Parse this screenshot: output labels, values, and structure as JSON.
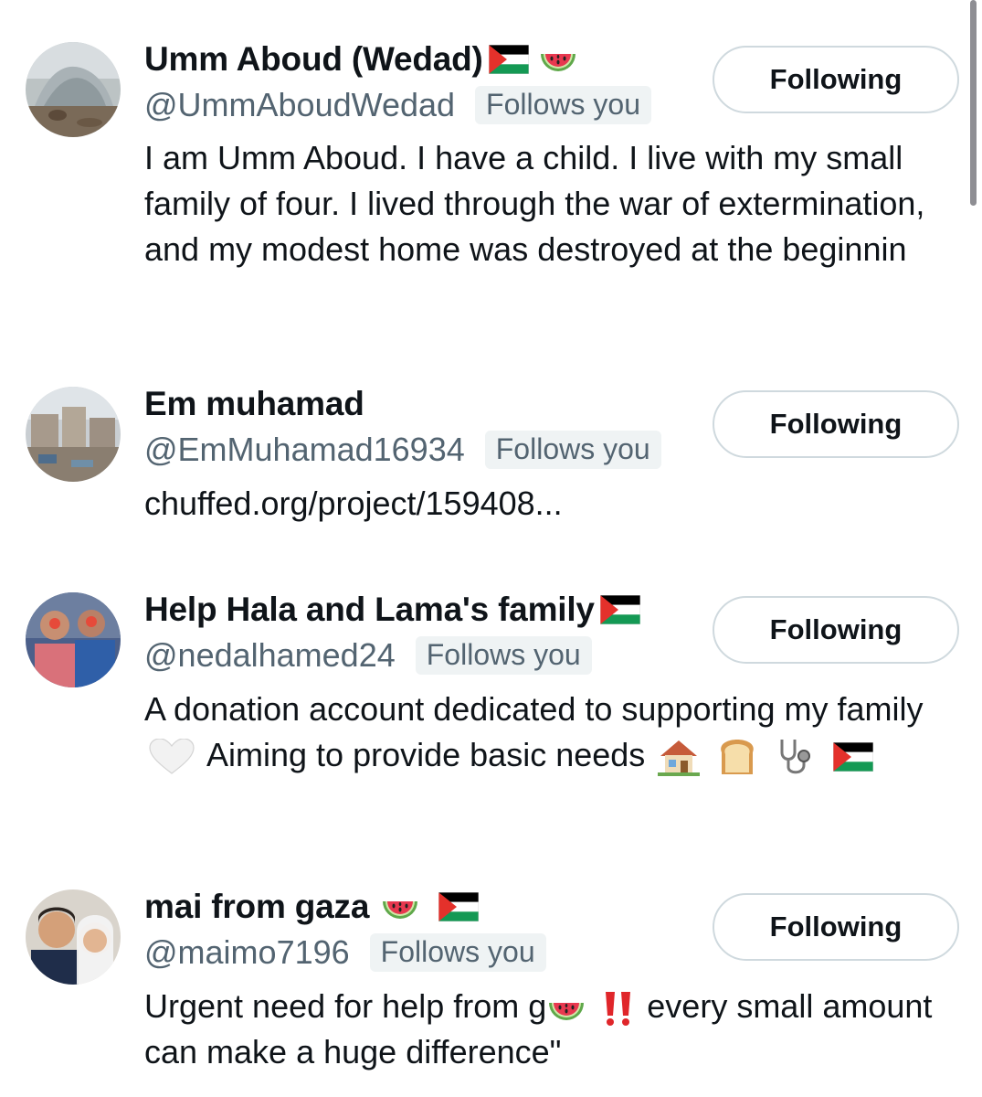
{
  "users": [
    {
      "name": "Umm Aboud (Wedad)",
      "handle": "@UmmAboudWedad",
      "follows_you": "Follows you",
      "button": "Following",
      "bio": "I am Umm Aboud. I have a child. I live with my small family of four. I lived through the war of extermination, and my modest home was destroyed at the beginnin",
      "name_emojis": [
        "palestine-flag",
        "watermelon"
      ]
    },
    {
      "name": "Em muhamad",
      "handle": "@EmMuhamad16934",
      "follows_you": "Follows you",
      "button": "Following",
      "bio": "chuffed.org/project/159408..."
    },
    {
      "name": "Help Hala and Lama's family",
      "handle": "@nedalhamed24",
      "follows_you": "Follows you",
      "button": "Following",
      "bio_part1": "A donation account dedicated to supporting my family",
      "bio_part2": "Aiming to provide basic needs",
      "name_emojis": [
        "palestine-flag"
      ],
      "bio_emojis": [
        "white-heart",
        "house",
        "bread",
        "stethoscope",
        "palestine-flag"
      ]
    },
    {
      "name": "mai from gaza",
      "handle": "@maimo7196",
      "follows_you": "Follows you",
      "button": "Following",
      "bio_part1": "Urgent need for help from g",
      "bio_part2": "every small amount can make a huge difference\"",
      "name_emojis": [
        "watermelon",
        "palestine-flag"
      ],
      "bio_emojis": [
        "watermelon",
        "double-exclamation"
      ]
    }
  ],
  "colors": {
    "text": "#0f1419",
    "secondary": "#536471",
    "badge_bg": "#eff3f4",
    "button_border": "#cfd9de"
  }
}
